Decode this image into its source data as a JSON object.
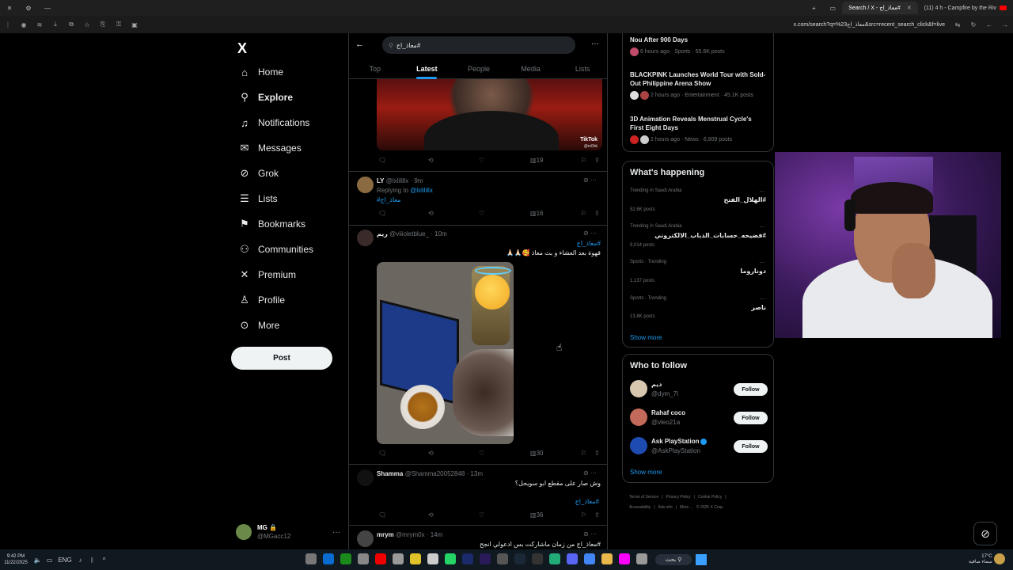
{
  "browser": {
    "tabs": [
      {
        "label": "Search / X - معاذ_اج#",
        "active": true
      },
      {
        "label": "(11) 4 h - Campfire by the Riv",
        "active": false
      }
    ],
    "url": "x.com/search?q=%23معاذ_اج&src=recent_search_click&f=live"
  },
  "nav": {
    "logo": "X",
    "items": [
      {
        "label": "Home",
        "icon": "home-icon"
      },
      {
        "label": "Explore",
        "icon": "search-icon"
      },
      {
        "label": "Notifications",
        "icon": "bell-icon"
      },
      {
        "label": "Messages",
        "icon": "mail-icon"
      },
      {
        "label": "Grok",
        "icon": "grok-icon"
      },
      {
        "label": "Lists",
        "icon": "list-icon"
      },
      {
        "label": "Bookmarks",
        "icon": "bookmark-icon"
      },
      {
        "label": "Communities",
        "icon": "people-icon"
      },
      {
        "label": "Premium",
        "icon": "x-icon"
      },
      {
        "label": "Profile",
        "icon": "person-icon"
      },
      {
        "label": "More",
        "icon": "more-circle-icon"
      }
    ],
    "post_label": "Post",
    "account": {
      "name": "MG 🔒",
      "handle": "@MGacc12"
    }
  },
  "search": {
    "query": "#معاذ_اج"
  },
  "tabs": [
    "Top",
    "Latest",
    "People",
    "Media",
    "Lists"
  ],
  "active_tab": "Latest",
  "media_top": {
    "badge": "TikTok",
    "handle": "@m0bk"
  },
  "tweets": [
    {
      "actions": {
        "views": "19"
      }
    },
    {
      "name": "LY",
      "handle": "@lxlilillx · 9m",
      "replying_prefix": "Replying to",
      "replying_handle": "@lxlilillx",
      "text": "#معاذ_اج",
      "actions": {
        "views": "16"
      }
    },
    {
      "name": "ريم",
      "handle": "@viiioletblue_ · 10m",
      "hashtag": "#معاذ_اج",
      "text": "قهوة بعد العشاء و بث معاذ 🥰🙏🏻🙏🏻",
      "actions": {
        "views": "30"
      }
    },
    {
      "name": "Shamma",
      "handle": "@Shamma20052848 · 13m",
      "text": "وش صار على مقطع ابو سويحل؟",
      "hashtag": "#معاذ_اج",
      "actions": {
        "views": "36"
      }
    },
    {
      "name": "mrym",
      "handle": "@mrym0x · 14m",
      "text": "#معاذ_اج من زمان ماشاركت بس ادعولي انجح"
    }
  ],
  "trending_top": [
    {
      "title": "Nou After 900 Days",
      "meta": "6 hours ago · Sports · 55.6K posts"
    },
    {
      "title": "BLACKPINK Launches World Tour with Sold-Out Philippine Arena Show",
      "meta": "2 hours ago · Entertainment · 45.1K posts"
    },
    {
      "title": "3D Animation Reveals Menstrual Cycle's First Eight Days",
      "meta": "2 hours ago · News · 6,809 posts"
    }
  ],
  "whats_happening": {
    "title": "What's happening",
    "items": [
      {
        "category": "Trending in Saudi Arabia",
        "name": "#الهلال_الفتح",
        "count": "52.6K posts"
      },
      {
        "category": "Trending in Saudi Arabia",
        "name": "#فضيحه_حسابات_الذباب_الالكتروني",
        "count": "9,014 posts"
      },
      {
        "category": "Sports · Trending",
        "name": "دوناروما",
        "count": "1,137 posts"
      },
      {
        "category": "Sports · Trending",
        "name": "ناصر",
        "count": "13.8K posts"
      }
    ],
    "show_more": "Show more"
  },
  "who_to_follow": {
    "title": "Who to follow",
    "items": [
      {
        "name": "ديم",
        "handle": "@dym_7l",
        "follow": "Follow"
      },
      {
        "name": "Rahaf coco",
        "handle": "@vleo21a",
        "follow": "Follow"
      },
      {
        "name": "Ask PlayStation",
        "handle": "@AskPlayStation",
        "follow": "Follow"
      }
    ],
    "show_more": "Show more"
  },
  "footer": {
    "links": [
      "Terms of Service",
      "|",
      "Privacy Policy",
      "|",
      "Cookie Policy",
      "|",
      "Accessibility",
      "|",
      "Ads info",
      "|",
      "More ...",
      "© 2025 X Corp."
    ]
  },
  "taskbar": {
    "time": "9:42 PM",
    "date": "11/22/2025",
    "lang": "ENG",
    "search": "بحث",
    "weather_temp": "17°C",
    "weather_desc": "سماء صافية"
  }
}
